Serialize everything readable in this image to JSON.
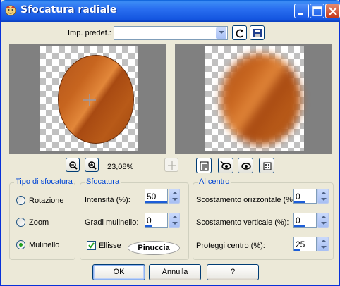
{
  "window": {
    "title": "Sfocatura radiale",
    "controls": [
      "minimize-icon",
      "maximize-icon",
      "close-icon"
    ]
  },
  "preset": {
    "label": "Imp. predef.:",
    "value": "",
    "icons": [
      "reset-icon",
      "save-icon"
    ]
  },
  "preview": {
    "zoom_text": "23,08%"
  },
  "toolbar_icons": [
    "zoom-out-icon",
    "zoom-in-icon",
    "move-icon",
    "proof-icon",
    "view-left-icon",
    "view-right-icon",
    "random-icon"
  ],
  "tipo": {
    "title": "Tipo di sfocatura",
    "options": [
      "Rotazione",
      "Zoom",
      "Mulinello"
    ],
    "selected": "Mulinello"
  },
  "sfocatura": {
    "title": "Sfocatura",
    "intensity_label": "Intensità (%):",
    "intensity_value": "50",
    "twist_label": "Gradi mulinello:",
    "twist_value": "0",
    "ellipse_label": "Ellisse",
    "ellipse_checked": true,
    "signature": "Pinuccia"
  },
  "centro": {
    "title": "Al centro",
    "h_offset_label": "Scostamento orizzontale (%):",
    "h_offset_value": "0",
    "v_offset_label": "Scostamento verticale (%):",
    "v_offset_value": "0",
    "protect_label": "Proteggi centro (%):",
    "protect_value": "25"
  },
  "buttons": {
    "ok": "OK",
    "cancel": "Annulla",
    "help": "?"
  },
  "colors": {
    "titlebar": "#1456e0",
    "face": "#ece9d8",
    "group_title": "#0046d5",
    "image_fill": "#b85a18"
  }
}
